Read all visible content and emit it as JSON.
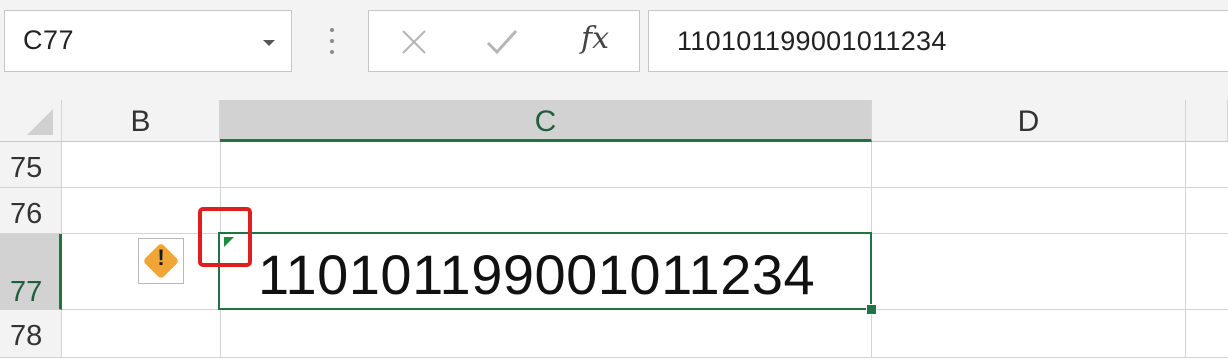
{
  "name_box": {
    "value": "C77"
  },
  "formula_bar": {
    "cancel_icon": "close-icon",
    "enter_icon": "check-icon",
    "function_label": "fx",
    "content": "110101199001011234"
  },
  "columns": [
    {
      "label": "B",
      "selected": false
    },
    {
      "label": "C",
      "selected": true
    },
    {
      "label": "D",
      "selected": false
    }
  ],
  "rows": [
    {
      "label": "75",
      "selected": false
    },
    {
      "label": "76",
      "selected": false
    },
    {
      "label": "77",
      "selected": true
    },
    {
      "label": "78",
      "selected": false
    }
  ],
  "active_cell": {
    "ref": "C77",
    "value": "110101199001011234",
    "has_error_indicator": true
  },
  "error_button": {
    "icon": "warning-icon",
    "symbol": "!"
  },
  "colors": {
    "selection_green": "#217346",
    "highlight_red": "#e11d1d",
    "warning_orange": "#f0a534"
  }
}
